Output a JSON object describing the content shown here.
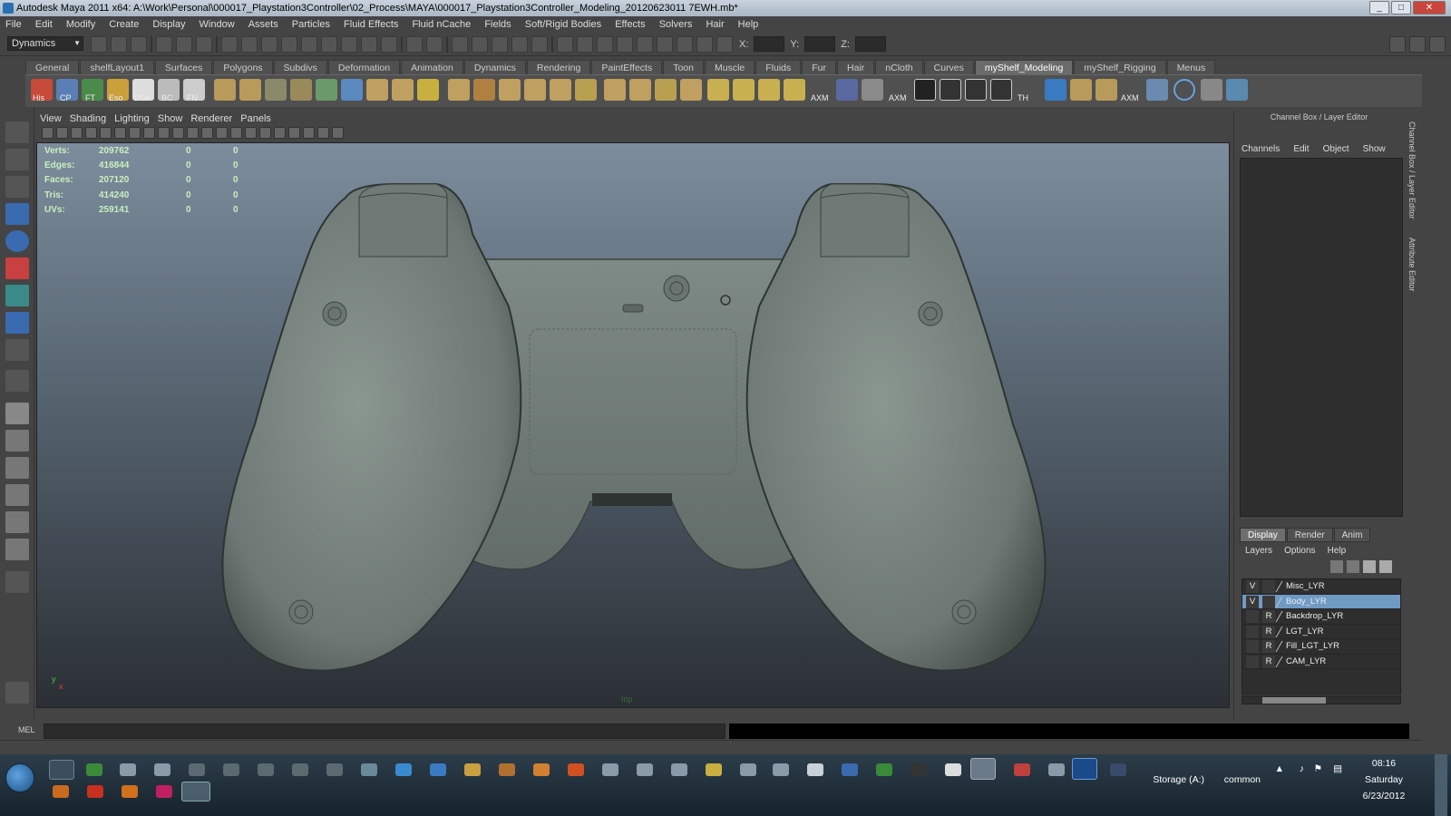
{
  "window": {
    "title": "Autodesk Maya 2011 x64: A:\\Work\\Personal\\000017_Playstation3Controller\\02_Process\\MAYA\\000017_Playstation3Controller_Modeling_20120623011 7EWH.mb*"
  },
  "menubar": [
    "File",
    "Edit",
    "Modify",
    "Create",
    "Display",
    "Window",
    "Assets",
    "Particles",
    "Fluid Effects",
    "Fluid nCache",
    "Fields",
    "Soft/Rigid Bodies",
    "Effects",
    "Solvers",
    "Hair",
    "Help"
  ],
  "statusline": {
    "mode": "Dynamics",
    "x_label": "X:",
    "y_label": "Y:",
    "z_label": "Z:"
  },
  "shelf": {
    "tabs": [
      "General",
      "shelfLayout1",
      "Surfaces",
      "Polygons",
      "Subdivs",
      "Deformation",
      "Animation",
      "Dynamics",
      "Rendering",
      "PaintEffects",
      "Toon",
      "Muscle",
      "Fluids",
      "Fur",
      "Hair",
      "nCloth",
      "Curves",
      "myShelf_Modeling",
      "myShelf_Rigging",
      "Menus"
    ],
    "active_tab": "myShelf_Modeling",
    "icon_labels": [
      "His",
      "CP",
      "FT",
      "Eso",
      "DSo",
      "BC",
      "FN",
      "AXM",
      "AXM",
      "TH",
      "AXM"
    ]
  },
  "panel": {
    "menus": [
      "View",
      "Shading",
      "Lighting",
      "Show",
      "Renderer",
      "Panels"
    ],
    "hud": [
      {
        "label": "Verts:",
        "v1": "209762",
        "v2": "0",
        "v3": "0"
      },
      {
        "label": "Edges:",
        "v1": "416844",
        "v2": "0",
        "v3": "0"
      },
      {
        "label": "Faces:",
        "v1": "207120",
        "v2": "0",
        "v3": "0"
      },
      {
        "label": "Tris:",
        "v1": "414240",
        "v2": "0",
        "v3": "0"
      },
      {
        "label": "UVs:",
        "v1": "259141",
        "v2": "0",
        "v3": "0"
      }
    ],
    "camera": "top",
    "axis_y": "y",
    "axis_x": "x"
  },
  "channelbox": {
    "title": "Channel Box / Layer Editor",
    "menus": [
      "Channels",
      "Edit",
      "Object",
      "Show"
    ],
    "layer_tabs": [
      "Display",
      "Render",
      "Anim"
    ],
    "layer_menus": [
      "Layers",
      "Options",
      "Help"
    ],
    "layers": [
      {
        "vis": "V",
        "type": "",
        "name": "Misc_LYR",
        "selected": false
      },
      {
        "vis": "V",
        "type": "",
        "name": "Body_LYR",
        "selected": true
      },
      {
        "vis": "",
        "type": "R",
        "name": "Backdrop_LYR",
        "selected": false
      },
      {
        "vis": "",
        "type": "R",
        "name": "LGT_LYR",
        "selected": false
      },
      {
        "vis": "",
        "type": "R",
        "name": "Fill_LGT_LYR",
        "selected": false
      },
      {
        "vis": "",
        "type": "R",
        "name": "CAM_LYR",
        "selected": false
      }
    ],
    "side_tabs": [
      "Channel Box / Layer Editor",
      "Attribute Editor"
    ]
  },
  "commandline": {
    "label": "MEL"
  },
  "taskbar": {
    "storage": "Storage (A:)",
    "common": "common",
    "time": "08:16",
    "day": "Saturday",
    "date": "6/23/2012"
  }
}
